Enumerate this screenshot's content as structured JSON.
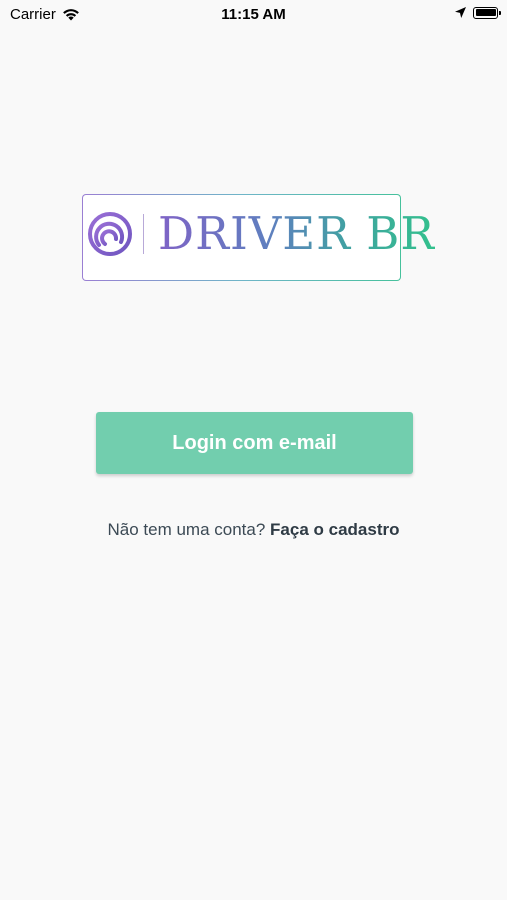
{
  "status_bar": {
    "carrier": "Carrier",
    "time": "11:15 AM",
    "wifi_icon": "wifi-icon",
    "location_icon": "location-arrow-icon",
    "battery_icon": "battery-icon"
  },
  "logo": {
    "text": "DRIVER BR",
    "mark_icon": "fingerprint-icon",
    "colors": {
      "start": "#7f63c6",
      "end": "#33c18d"
    }
  },
  "login": {
    "label": "Login com e-mail",
    "color": "#72ceae"
  },
  "signup": {
    "prompt": "Não tem uma conta?",
    "link": "Faça o cadastro"
  }
}
